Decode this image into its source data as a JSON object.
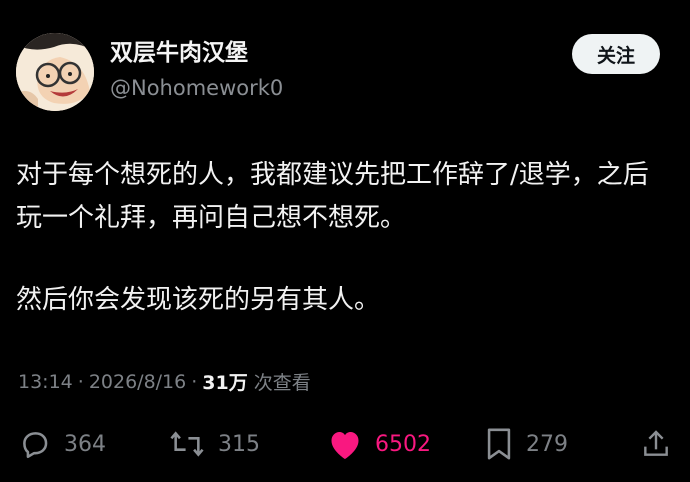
{
  "author": {
    "display_name": "双层牛肉汉堡",
    "handle": "@Nohomework0"
  },
  "follow_button_label": "关注",
  "tweet": {
    "paragraphs": [
      "对于每个想死的人，我都建议先把工作辞了/退学，之后玩一个礼拜，再问自己想不想死。",
      "然后你会发现该死的另有其人。"
    ]
  },
  "meta": {
    "time": "13:14",
    "date": "2026/8/16",
    "separator": "·",
    "views_count": "31万",
    "views_label": "次查看"
  },
  "actions": {
    "replies": "364",
    "retweets": "315",
    "likes": "6502",
    "bookmarks": "279",
    "like_color": "#f91880"
  },
  "icons": [
    "reply-icon",
    "retweet-icon",
    "like-icon",
    "bookmark-icon",
    "share-icon"
  ]
}
